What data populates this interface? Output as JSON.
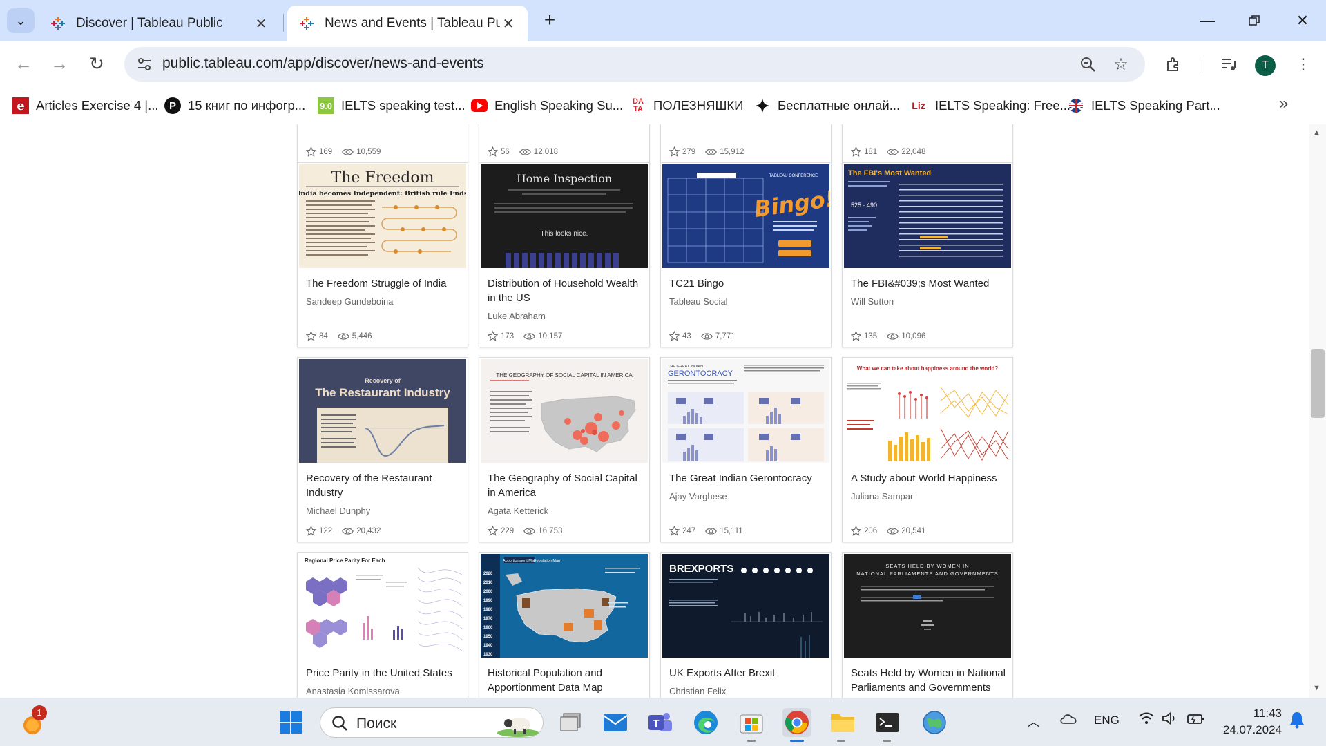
{
  "browser": {
    "tabs": [
      {
        "title": "Discover | Tableau Public",
        "active": false
      },
      {
        "title": "News and Events | Tableau Publ",
        "active": true
      }
    ],
    "url": "public.tableau.com/app/discover/news-and-events",
    "profile_initial": "T",
    "bookmarks": [
      {
        "label": "Articles Exercise 4 |...",
        "icon": "e"
      },
      {
        "label": "15 книг по инфогр...",
        "icon": "P"
      },
      {
        "label": "IELTS speaking test...",
        "icon": "9.0"
      },
      {
        "label": "English Speaking Su...",
        "icon": "youtube"
      },
      {
        "label": "ПОЛЕЗНЯШКИ",
        "icon": "DA TA"
      },
      {
        "label": "Бесплатные онлай...",
        "icon": "diamond"
      },
      {
        "label": "IELTS Speaking: Free...",
        "icon": "Liz"
      },
      {
        "label": "IELTS Speaking Part...",
        "icon": "uk-flag"
      }
    ]
  },
  "gallery": {
    "top_row_stats": [
      {
        "favorites": "169",
        "views": "10,559"
      },
      {
        "favorites": "56",
        "views": "12,018"
      },
      {
        "favorites": "279",
        "views": "15,912"
      },
      {
        "favorites": "181",
        "views": "22,048"
      }
    ],
    "cards": [
      {
        "title": "The Freedom Struggle of India",
        "author": "Sandeep Gundeboina",
        "favorites": "84",
        "views": "5,446",
        "thumb_heading": "The Freedom",
        "thumb_sub": "India becomes Independent: British rule Ends"
      },
      {
        "title": "Distribution of Household Wealth in the US",
        "author": "Luke Abraham",
        "favorites": "173",
        "views": "10,157",
        "thumb_heading": "Home Inspection",
        "thumb_sub": "This looks nice."
      },
      {
        "title": "TC21 Bingo",
        "author": "Tableau Social",
        "favorites": "43",
        "views": "7,771",
        "thumb_heading": "Bingo!",
        "thumb_sub": "TABLEAU CONFERENCE"
      },
      {
        "title": "The FBI&#039;s Most Wanted",
        "author": "Will Sutton",
        "favorites": "135",
        "views": "10,096",
        "thumb_heading": "The FBI's Most Wanted",
        "thumb_sub": "525 · 490"
      },
      {
        "title": "Recovery of the Restaurant Industry",
        "author": "Michael Dunphy",
        "favorites": "122",
        "views": "20,432",
        "thumb_heading": "The Restaurant Industry",
        "thumb_sub": "Recovery of"
      },
      {
        "title": "The Geography of Social Capital in America",
        "author": "Agata Ketterick",
        "favorites": "229",
        "views": "16,753",
        "thumb_heading": "THE GEOGRAPHY OF SOCIAL CAPITAL IN AMERICA",
        "thumb_sub": ""
      },
      {
        "title": "The Great Indian Gerontocracy",
        "author": "Ajay Varghese",
        "favorites": "247",
        "views": "15,111",
        "thumb_heading": "GERONTOCRACY",
        "thumb_sub": "THE GREAT INDIAN"
      },
      {
        "title": "A Study about World Happiness",
        "author": "Juliana Sampar",
        "favorites": "206",
        "views": "20,541",
        "thumb_heading": "What we can take about happiness around the world?",
        "thumb_sub": ""
      },
      {
        "title": "Price Parity in the United States",
        "author": "Anastasia Komissarova",
        "favorites": "",
        "views": "",
        "thumb_heading": "Regional Price Parity For Each",
        "thumb_sub": ""
      },
      {
        "title": "Historical Population and Apportionment Data Map",
        "author": "",
        "favorites": "",
        "views": "",
        "thumb_heading": "Apportionment Map",
        "thumb_sub": "Population Map"
      },
      {
        "title": "UK Exports After Brexit",
        "author": "Christian Felix",
        "favorites": "",
        "views": "",
        "thumb_heading": "BREXPORTS",
        "thumb_sub": ""
      },
      {
        "title": "Seats Held by Women in National Parliaments and Governments",
        "author": "",
        "favorites": "",
        "views": "",
        "thumb_heading": "SEATS HELD BY WOMEN IN",
        "thumb_sub": "NATIONAL PARLIAMENTS AND GOVERNMENTS"
      }
    ]
  },
  "taskbar": {
    "search_placeholder": "Поиск",
    "notification_count": "1",
    "language": "ENG",
    "time": "11:43",
    "date": "24.07.2024"
  },
  "colors": {
    "tabstrip": "#d3e3fd",
    "omnibox": "#e9eef6",
    "taskbar": "#e6eaf1"
  }
}
